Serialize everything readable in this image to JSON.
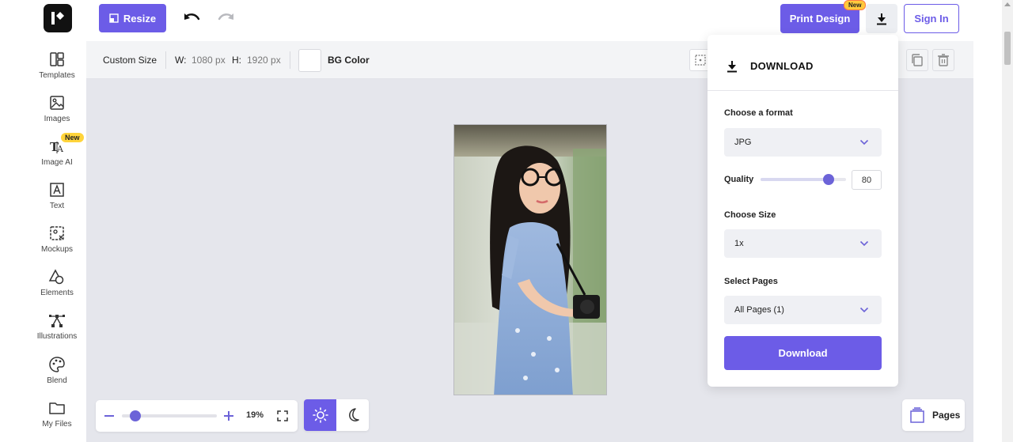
{
  "header": {
    "resize_label": "Resize",
    "print_label": "Print Design",
    "print_badge": "New",
    "signin_label": "Sign In"
  },
  "sidebar": {
    "items": [
      {
        "label": "Templates",
        "icon": "templates-icon"
      },
      {
        "label": "Images",
        "icon": "image-icon"
      },
      {
        "label": "Image AI",
        "icon": "text-ai-icon",
        "badge": "New"
      },
      {
        "label": "Text",
        "icon": "text-icon"
      },
      {
        "label": "Mockups",
        "icon": "mockup-icon"
      },
      {
        "label": "Elements",
        "icon": "shapes-icon"
      },
      {
        "label": "Illustrations",
        "icon": "pen-tool-icon"
      },
      {
        "label": "Blend",
        "icon": "palette-icon"
      },
      {
        "label": "My Files",
        "icon": "folder-icon"
      }
    ]
  },
  "toolbar": {
    "custom_size": "Custom Size",
    "w_label": "W:",
    "w_value": "1080 px",
    "h_label": "H:",
    "h_value": "1920 px",
    "bg_color_label": "BG Color"
  },
  "zoom": {
    "value": "19%",
    "fraction": 0.19
  },
  "pages": {
    "label": "Pages"
  },
  "download_panel": {
    "title": "DOWNLOAD",
    "format_label": "Choose a format",
    "format_value": "JPG",
    "quality_label": "Quality",
    "quality_value": "80",
    "quality_fraction": 0.8,
    "size_label": "Choose Size",
    "size_value": "1x",
    "pages_label": "Select Pages",
    "pages_value": "All Pages (1)",
    "button_label": "Download"
  },
  "colors": {
    "accent": "#6c5ce7",
    "canvas_bg": "#e5e6ec",
    "badge": "#ffd43b"
  }
}
